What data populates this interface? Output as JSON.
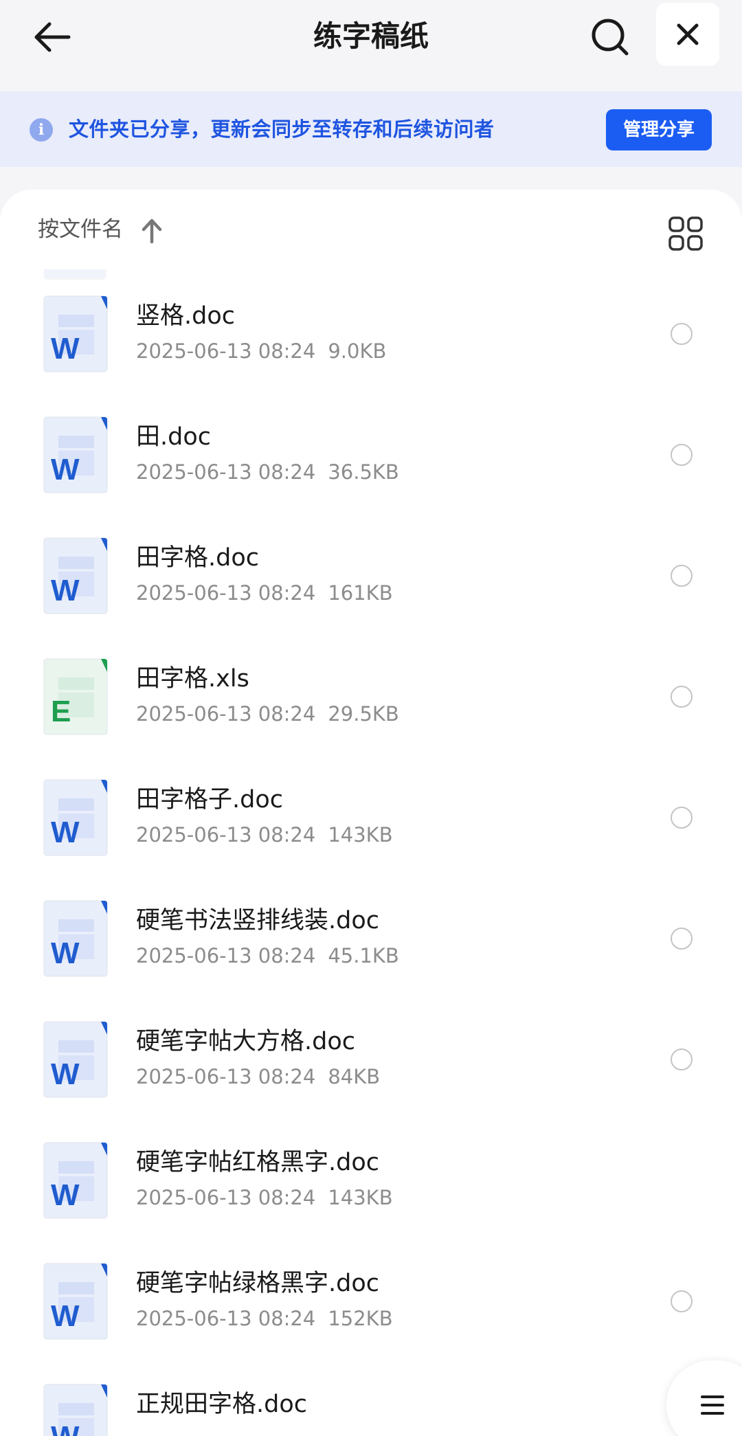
{
  "header": {
    "title": "练字稿纸"
  },
  "notice": {
    "text": "文件夹已分享，更新会同步至转存和后续访问者",
    "button": "管理分享",
    "icon": "info-icon",
    "icon_glyph": "i"
  },
  "sort": {
    "label": "按文件名",
    "direction_icon": "arrow-up-icon",
    "view_icon": "grid-view-icon"
  },
  "colors": {
    "accent": "#1b5cf2",
    "banner_bg": "#e8ecfb",
    "word_blue": "#1f5ccf",
    "excel_green": "#1e9e4f"
  },
  "files": [
    {
      "name": "竖格.doc",
      "date": "2025-06-13 08:24",
      "size": "9.0KB",
      "type": "word",
      "icon_letter": "W"
    },
    {
      "name": "田.doc",
      "date": "2025-06-13 08:24",
      "size": "36.5KB",
      "type": "word",
      "icon_letter": "W"
    },
    {
      "name": "田字格.doc",
      "date": "2025-06-13 08:24",
      "size": "161KB",
      "type": "word",
      "icon_letter": "W"
    },
    {
      "name": "田字格.xls",
      "date": "2025-06-13 08:24",
      "size": "29.5KB",
      "type": "excel",
      "icon_letter": "E"
    },
    {
      "name": "田字格子.doc",
      "date": "2025-06-13 08:24",
      "size": "143KB",
      "type": "word",
      "icon_letter": "W"
    },
    {
      "name": "硬笔书法竖排线装.doc",
      "date": "2025-06-13 08:24",
      "size": "45.1KB",
      "type": "word",
      "icon_letter": "W"
    },
    {
      "name": "硬笔字帖大方格.doc",
      "date": "2025-06-13 08:24",
      "size": "84KB",
      "type": "word",
      "icon_letter": "W"
    },
    {
      "name": "硬笔字帖红格黑字.doc",
      "date": "2025-06-13 08:24",
      "size": "143KB",
      "type": "word",
      "icon_letter": "W"
    },
    {
      "name": "硬笔字帖绿格黑字.doc",
      "date": "2025-06-13 08:24",
      "size": "152KB",
      "type": "word",
      "icon_letter": "W"
    },
    {
      "name": "正规田字格.doc",
      "date": "",
      "size": "",
      "type": "word",
      "icon_letter": "W"
    }
  ]
}
